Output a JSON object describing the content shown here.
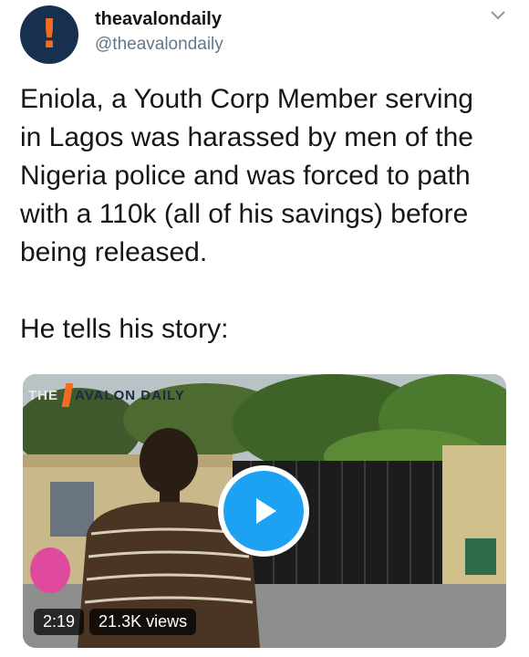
{
  "author": {
    "name": "theavalondaily",
    "handle": "@theavalondaily",
    "avatar_icon": "exclamation-logo-icon",
    "avatar_bg": "#17304f",
    "avatar_accent": "#f26b21"
  },
  "tweet": {
    "text": "Eniola, a Youth Corp Member serving\nin Lagos was harassed by men of the\nNigeria police and was forced to path\nwith a 110k (all of his savings) before\nbeing released.\n\nHe tells his story:"
  },
  "media": {
    "watermark_the": "THE",
    "watermark_brand": "AVALON DAILY",
    "duration": "2:19",
    "views": "21.3K views",
    "play_icon": "play-icon",
    "play_color": "#1da1f2"
  },
  "menu_icon": "chevron-down-icon"
}
